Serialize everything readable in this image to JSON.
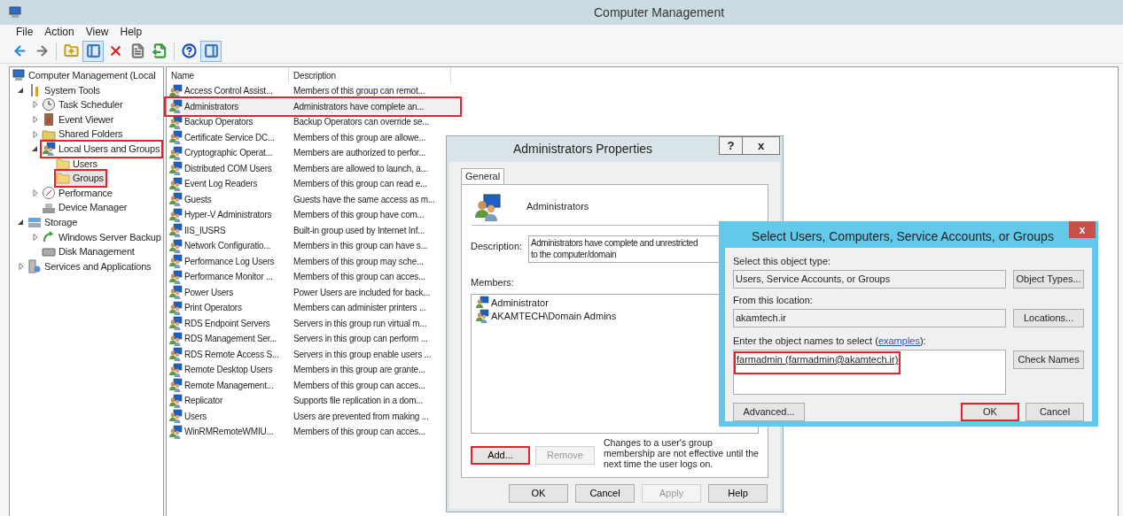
{
  "window": {
    "title": "Computer Management"
  },
  "menu": [
    {
      "label": "File"
    },
    {
      "label": "Action"
    },
    {
      "label": "View"
    },
    {
      "label": "Help"
    }
  ],
  "toolbar": [
    {
      "kind": "back",
      "pressed": false
    },
    {
      "kind": "forward",
      "pressed": false
    },
    {
      "kind": "sep"
    },
    {
      "kind": "up",
      "pressed": false
    },
    {
      "kind": "tree",
      "pressed": true
    },
    {
      "kind": "delete",
      "pressed": false
    },
    {
      "kind": "properties",
      "pressed": false
    },
    {
      "kind": "export",
      "pressed": false
    },
    {
      "kind": "sep"
    },
    {
      "kind": "help",
      "pressed": false
    },
    {
      "kind": "actionpane",
      "pressed": true
    }
  ],
  "tree": [
    {
      "label": "Computer Management (Local",
      "kind": "computer",
      "selected": false,
      "highlighted": false,
      "children": [
        {
          "label": "System Tools",
          "kind": "tools",
          "expanded": true,
          "selected": false,
          "highlighted": false,
          "children": [
            {
              "label": "Task Scheduler",
              "kind": "clock",
              "expanded": false,
              "selected": false,
              "highlighted": false
            },
            {
              "label": "Event Viewer",
              "kind": "log",
              "expanded": false,
              "selected": false,
              "highlighted": false
            },
            {
              "label": "Shared Folders",
              "kind": "share",
              "expanded": false,
              "selected": false,
              "highlighted": false
            },
            {
              "label": "Local Users and Groups",
              "kind": "users",
              "expanded": true,
              "selected": false,
              "highlighted": true,
              "children": [
                {
                  "label": "Users",
                  "kind": "folder",
                  "selected": false,
                  "highlighted": false
                },
                {
                  "label": "Groups",
                  "kind": "folder",
                  "selected": true,
                  "highlighted": true
                }
              ]
            },
            {
              "label": "Performance",
              "kind": "performance",
              "expanded": false,
              "selected": false,
              "highlighted": false
            },
            {
              "label": "Device Manager",
              "kind": "device",
              "selected": false,
              "highlighted": false
            }
          ]
        },
        {
          "label": "Storage",
          "kind": "storage",
          "expanded": true,
          "selected": false,
          "highlighted": false,
          "children": [
            {
              "label": "Windows Server Backup",
              "kind": "backup",
              "expanded": false,
              "selected": false,
              "highlighted": false
            },
            {
              "label": "Disk Management",
              "kind": "disk",
              "selected": false,
              "highlighted": false
            }
          ]
        },
        {
          "label": "Services and Applications",
          "kind": "services",
          "expanded": false,
          "selected": false,
          "highlighted": false
        }
      ]
    }
  ],
  "list": {
    "columns": [
      "Name",
      "Description"
    ],
    "rows": [
      {
        "name": "Access Control Assist...",
        "description": "Members of this group can remot...",
        "selected": false,
        "highlighted": false
      },
      {
        "name": "Administrators",
        "description": "Administrators have complete an...",
        "selected": true,
        "highlighted": true
      },
      {
        "name": "Backup Operators",
        "description": "Backup Operators can override se...",
        "selected": false,
        "highlighted": false
      },
      {
        "name": "Certificate Service DC...",
        "description": "Members of this group are allowe...",
        "selected": false,
        "highlighted": false
      },
      {
        "name": "Cryptographic Operat...",
        "description": "Members are authorized to perfor...",
        "selected": false,
        "highlighted": false
      },
      {
        "name": "Distributed COM Users",
        "description": "Members are allowed to launch, a...",
        "selected": false,
        "highlighted": false
      },
      {
        "name": "Event Log Readers",
        "description": "Members of this group can read e...",
        "selected": false,
        "highlighted": false
      },
      {
        "name": "Guests",
        "description": "Guests have the same access as m...",
        "selected": false,
        "highlighted": false
      },
      {
        "name": "Hyper-V Administrators",
        "description": "Members of this group have com...",
        "selected": false,
        "highlighted": false
      },
      {
        "name": "IIS_IUSRS",
        "description": "Built-in group used by Internet Inf...",
        "selected": false,
        "highlighted": false
      },
      {
        "name": "Network Configuratio...",
        "description": "Members in this group can have s...",
        "selected": false,
        "highlighted": false
      },
      {
        "name": "Performance Log Users",
        "description": "Members of this group may sche...",
        "selected": false,
        "highlighted": false
      },
      {
        "name": "Performance Monitor ...",
        "description": "Members of this group can acces...",
        "selected": false,
        "highlighted": false
      },
      {
        "name": "Power Users",
        "description": "Power Users are included for back...",
        "selected": false,
        "highlighted": false
      },
      {
        "name": "Print Operators",
        "description": "Members can administer printers ...",
        "selected": false,
        "highlighted": false
      },
      {
        "name": "RDS Endpoint Servers",
        "description": "Servers in this group run virtual m...",
        "selected": false,
        "highlighted": false
      },
      {
        "name": "RDS Management Ser...",
        "description": "Servers in this group can perform ...",
        "selected": false,
        "highlighted": false
      },
      {
        "name": "RDS Remote Access S...",
        "description": "Servers in this group enable users ...",
        "selected": false,
        "highlighted": false
      },
      {
        "name": "Remote Desktop Users",
        "description": "Members in this group are grante...",
        "selected": false,
        "highlighted": false
      },
      {
        "name": "Remote Management...",
        "description": "Members of this group can acces...",
        "selected": false,
        "highlighted": false
      },
      {
        "name": "Replicator",
        "description": "Supports file replication in a dom...",
        "selected": false,
        "highlighted": false
      },
      {
        "name": "Users",
        "description": "Users are prevented from making ...",
        "selected": false,
        "highlighted": false
      },
      {
        "name": "WinRMRemoteWMIU...",
        "description": "Members of this group can acces...",
        "selected": false,
        "highlighted": false
      }
    ]
  },
  "properties_dialog": {
    "title": "Administrators Properties",
    "help_button": "?",
    "close_button": "x",
    "tabs": [
      {
        "label": "General",
        "selected": true
      }
    ],
    "group_name": "Administrators",
    "description_label": "Description:",
    "description_lines": [
      "Administrators have complete and unrestricted",
      "to the computer/domain"
    ],
    "members_label": "Members:",
    "members": [
      {
        "name": "Administrator",
        "kind": "user"
      },
      {
        "name": "AKAMTECH\\Domain Admins",
        "kind": "group"
      }
    ],
    "member_buttons": [
      {
        "label": "Add...",
        "disabled": false,
        "highlighted": true
      },
      {
        "label": "Remove",
        "disabled": true,
        "highlighted": false
      }
    ],
    "note": "Changes to a user's group membership are not effective until the next time the user logs on.",
    "footer_buttons": [
      {
        "label": "OK",
        "disabled": false
      },
      {
        "label": "Cancel",
        "disabled": false
      },
      {
        "label": "Apply",
        "disabled": true
      },
      {
        "label": "Help",
        "disabled": false
      }
    ]
  },
  "select_dialog": {
    "title": "Select Users, Computers, Service Accounts, or Groups",
    "close_button": "x",
    "object_type_label": "Select this object type:",
    "object_type": "Users, Service Accounts, or Groups",
    "object_types_button": "Object Types...",
    "location_label": "From this location:",
    "location": "akamtech.ir",
    "locations_button": "Locations...",
    "names_label": "Enter the object names to select (",
    "names_link": "examples",
    "names_label_end": "):",
    "names_value": "farmadmin (farmadmin@akamtech.ir)",
    "names_highlighted": true,
    "check_names_button": "Check Names",
    "buttons": [
      {
        "label": "Advanced...",
        "highlighted": false
      },
      {
        "label": "OK",
        "highlighted": true
      },
      {
        "label": "Cancel",
        "highlighted": false
      }
    ]
  }
}
